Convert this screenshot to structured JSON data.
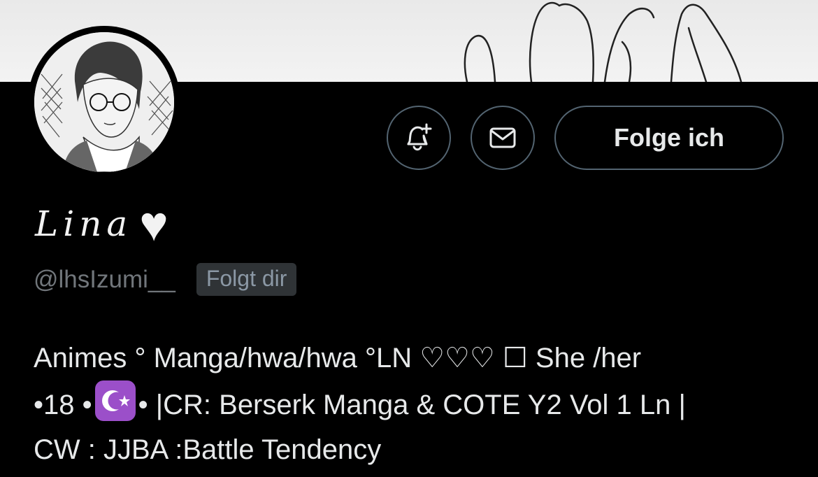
{
  "profile": {
    "display_name": "Lina",
    "heart": "♥",
    "handle": "@lhsIzumi__",
    "follows_you": "Folgt dir",
    "follow_button": "Folge ich",
    "bio": {
      "line1": "Animes ° Manga/hwa/hwa °LN ♡♡♡ ☐ She /her",
      "line2_start": "•18 •",
      "line2_emoji": "star-and-crescent-emoji",
      "line2_end": "• |CR: Berserk Manga & COTE Y2 Vol 1 Ln |",
      "line3": "CW : JJBA :Battle Tendency"
    }
  },
  "icons": {
    "notify": "bell-plus-icon",
    "message": "envelope-icon"
  },
  "colors": {
    "background": "#000000",
    "text": "#e7e9ea",
    "secondary_text": "#71767b",
    "border": "#536471",
    "badge_bg": "#2f3336",
    "emoji_bg": "#9b4fc9"
  }
}
